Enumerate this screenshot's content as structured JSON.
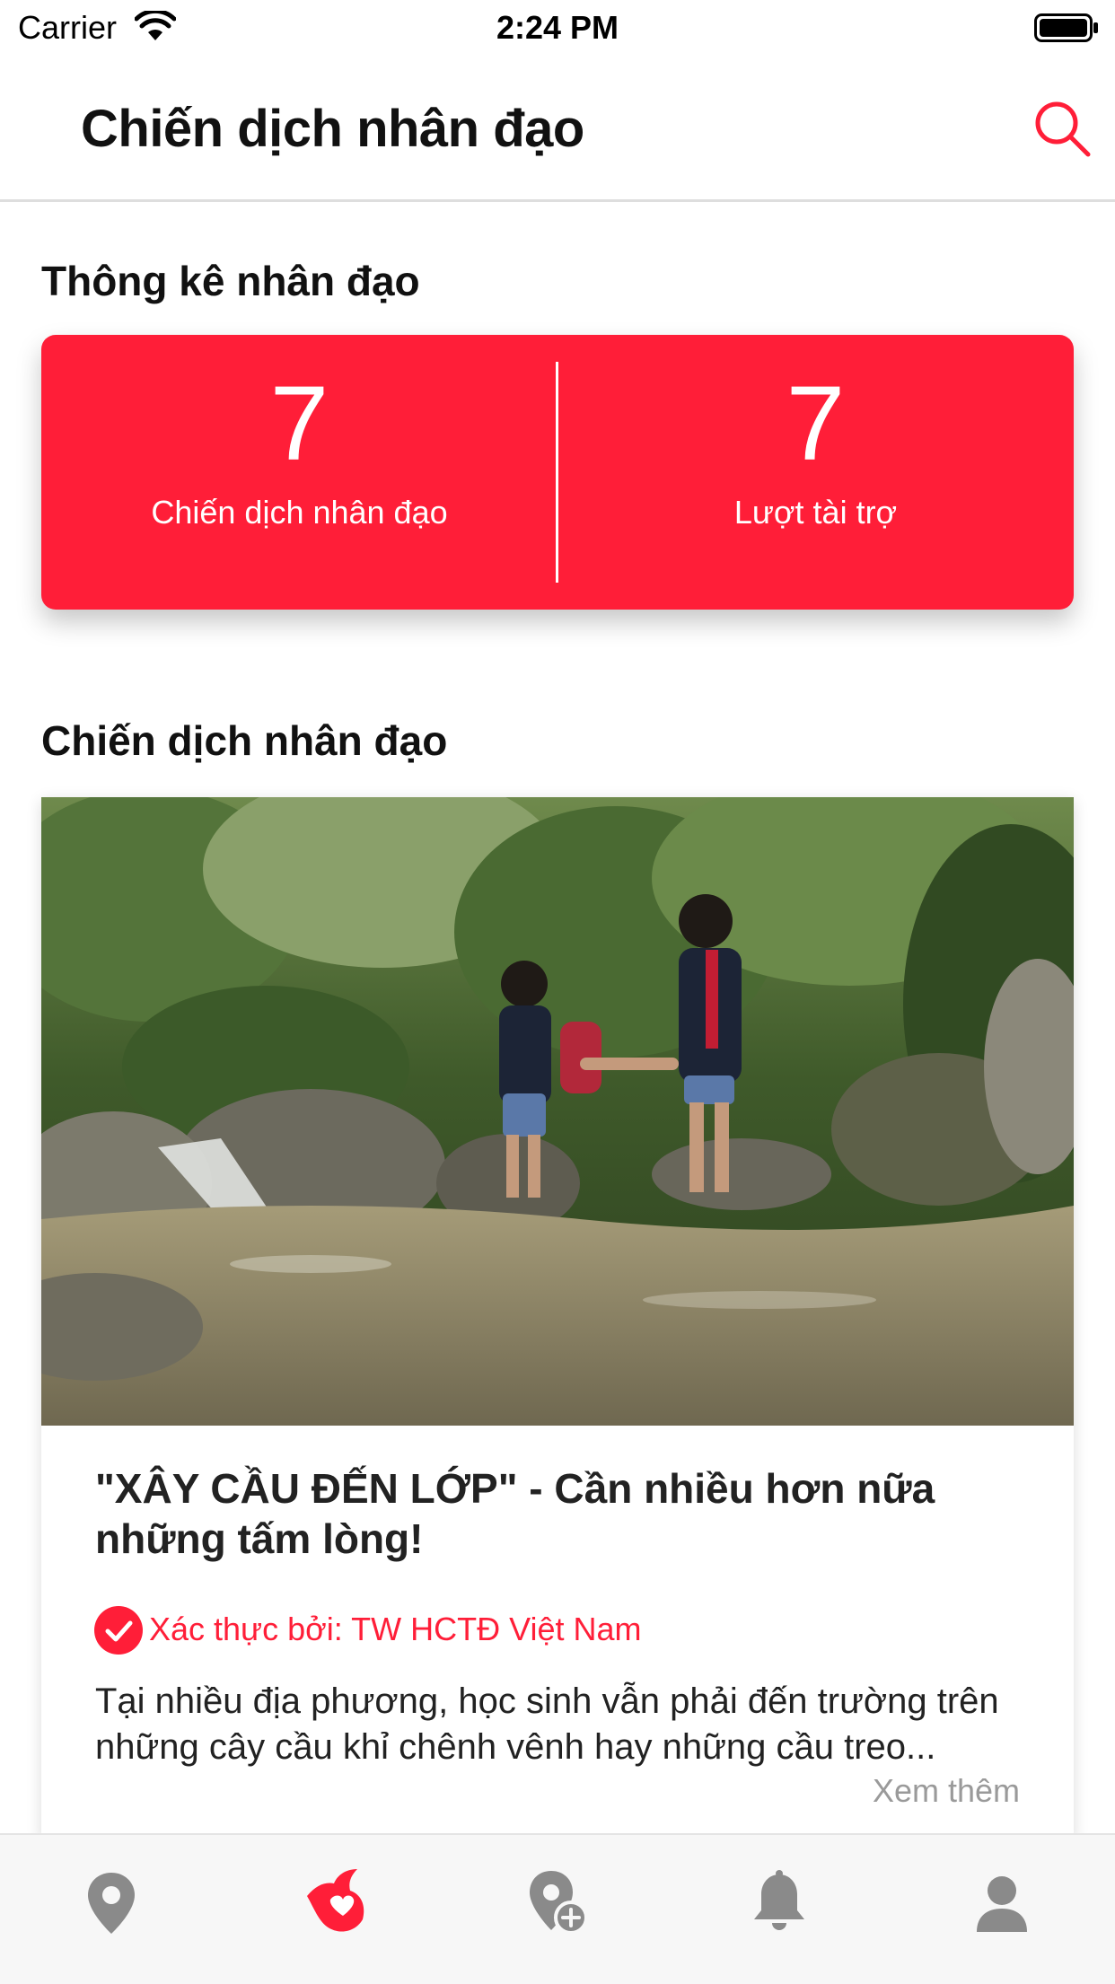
{
  "status_bar": {
    "carrier": "Carrier",
    "time": "2:24 PM"
  },
  "nav": {
    "title": "Chiến dịch nhân đạo",
    "search_icon": "search-icon"
  },
  "stats_section": {
    "title": "Thông kê nhân đạo",
    "items": [
      {
        "value": "7",
        "label": "Chiến dịch nhân đạo"
      },
      {
        "value": "7",
        "label": "Lượt tài trợ"
      }
    ]
  },
  "campaigns_section": {
    "title": "Chiến dịch nhân đạo",
    "items": [
      {
        "title": "\"XÂY CẦU ĐẾN LỚP\" - Cần nhiều hơn nữa những tấm lòng!",
        "verified_text": "Xác thực bởi: TW HCTĐ Việt Nam",
        "description": "Tại nhiều địa phương, học sinh vẫn phải đến trường trên những cây cầu khỉ chênh vênh hay những cầu treo...",
        "see_more": "Xem thêm"
      }
    ]
  },
  "tab_bar": {
    "tabs": [
      {
        "icon": "map-pin-icon",
        "active": false
      },
      {
        "icon": "red-cross-heart-icon",
        "active": true
      },
      {
        "icon": "add-location-icon",
        "active": false
      },
      {
        "icon": "bell-icon",
        "active": false
      },
      {
        "icon": "profile-icon",
        "active": false
      }
    ]
  },
  "colors": {
    "accent": "#ff1e38",
    "tab_inactive": "#8a8a8a",
    "text_primary": "#111111",
    "text_secondary": "#9a9a9a"
  }
}
